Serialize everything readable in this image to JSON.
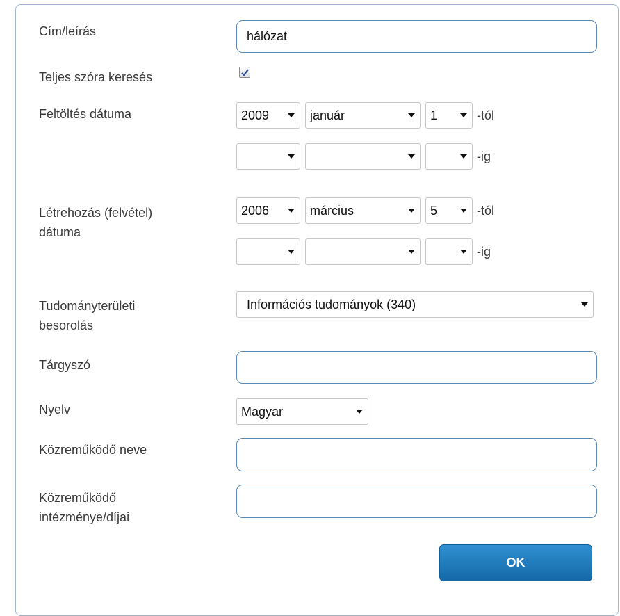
{
  "form": {
    "title_desc": {
      "label": "Cím/leírás",
      "value": "hálózat"
    },
    "whole_word": {
      "label": "Teljes szóra keresés",
      "checked": true
    },
    "upload_date": {
      "label": "Feltöltés dátuma",
      "from": {
        "year": "2009",
        "month": "január",
        "day": "1",
        "suffix": "-tól"
      },
      "to": {
        "year": "",
        "month": "",
        "day": "",
        "suffix": "-ig"
      }
    },
    "creation_date": {
      "label_line1": "Létrehozás (felvétel)",
      "label_line2": "dátuma",
      "from": {
        "year": "2006",
        "month": "március",
        "day": "5",
        "suffix": "-tól"
      },
      "to": {
        "year": "",
        "month": "",
        "day": "",
        "suffix": "-ig"
      }
    },
    "field_class": {
      "label_line1": "Tudományterületi",
      "label_line2": "besorolás",
      "value": "Információs tudományok (340)"
    },
    "subject": {
      "label": "Tárgyszó",
      "value": ""
    },
    "language": {
      "label": "Nyelv",
      "value": "Magyar"
    },
    "contributor_name": {
      "label": "Közreműködő neve",
      "value": ""
    },
    "contributor_inst": {
      "label_line1": "Közreműködő",
      "label_line2": "intézménye/díjai",
      "value": ""
    },
    "ok_label": "OK"
  },
  "colors": {
    "accent": "#1a74b8",
    "input_border": "#5b87b3",
    "panel_border": "#9fb7cf"
  }
}
